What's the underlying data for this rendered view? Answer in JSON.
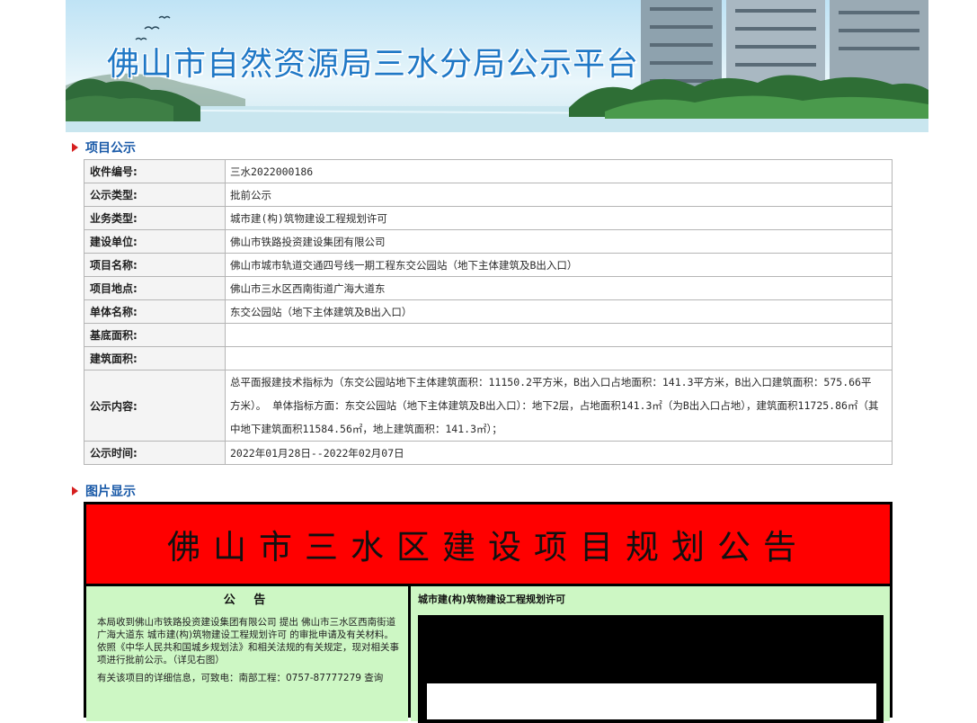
{
  "banner": {
    "title": "佛山市自然资源局三水分局公示平台"
  },
  "sections": {
    "project": "项目公示",
    "images": "图片显示"
  },
  "project_table": [
    {
      "label": "收件编号:",
      "value": "三水2022000186"
    },
    {
      "label": "公示类型:",
      "value": "批前公示"
    },
    {
      "label": "业务类型:",
      "value": "城市建(构)筑物建设工程规划许可"
    },
    {
      "label": "建设单位:",
      "value": "佛山市铁路投资建设集团有限公司"
    },
    {
      "label": "项目名称:",
      "value": "佛山市城市轨道交通四号线一期工程东交公园站（地下主体建筑及B出入口）"
    },
    {
      "label": "项目地点:",
      "value": "佛山市三水区西南街道广海大道东"
    },
    {
      "label": "单体名称:",
      "value": "东交公园站（地下主体建筑及B出入口）"
    },
    {
      "label": "基底面积:",
      "value": ""
    },
    {
      "label": "建筑面积:",
      "value": ""
    },
    {
      "label": "公示内容:",
      "value": "总平面报建技术指标为（东交公园站地下主体建筑面积：11150.2平方米，B出入口占地面积：141.3平方米，B出入口建筑面积：575.66平方米）。 单体指标方面：东交公园站（地下主体建筑及B出入口）：地下2层，占地面积141.3㎡（为B出入口占地），建筑面积11725.86㎡（其中地下建筑面积11584.56㎡，地上建筑面积：141.3㎡）；"
    },
    {
      "label": "公示时间:",
      "value": "2022年01月28日--2022年02月07日"
    }
  ],
  "notice": {
    "headline": "佛山市三水区建设项目规划公告",
    "left_title": "公 告",
    "left_para1": "本局收到佛山市铁路投资建设集团有限公司 提出 佛山市三水区西南街道广海大道东 城市建(构)筑物建设工程规划许可 的审批申请及有关材料。 依照《中华人民共和国城乡规划法》和相关法规的有关规定，现对相关事项进行批前公示。（详见右图）",
    "left_para2": "有关该项目的详细信息，可致电：南部工程：0757-87777279 查询",
    "right_title": "城市建(构)筑物建设工程规划许可"
  },
  "colors": {
    "accent_blue": "#1a5aa8",
    "notice_red": "#ff0000",
    "notice_green": "#cdf7c4"
  }
}
